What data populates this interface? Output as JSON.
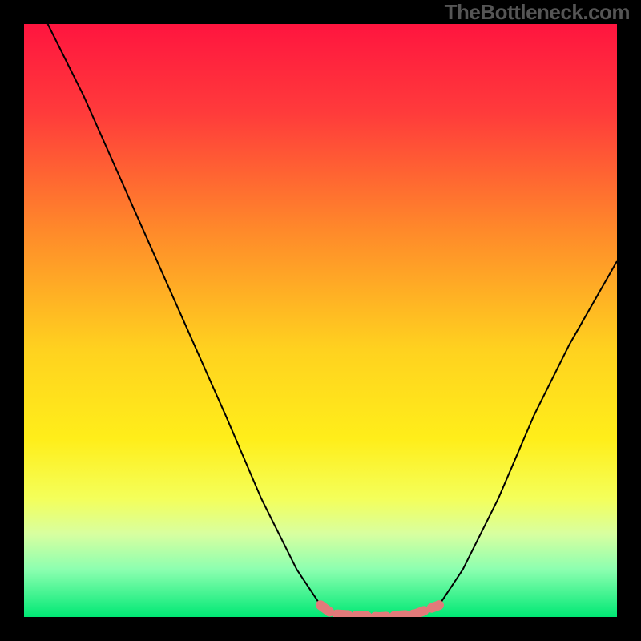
{
  "watermark": "TheBottleneck.com",
  "chart_data": {
    "type": "line",
    "title": "",
    "xlabel": "",
    "ylabel": "",
    "xlim": [
      0,
      100
    ],
    "ylim": [
      0,
      100
    ],
    "gradient_stops": [
      {
        "offset": 0,
        "color": "#ff153f"
      },
      {
        "offset": 15,
        "color": "#ff3b3b"
      },
      {
        "offset": 35,
        "color": "#ff8a2a"
      },
      {
        "offset": 55,
        "color": "#ffd21f"
      },
      {
        "offset": 70,
        "color": "#ffee1a"
      },
      {
        "offset": 80,
        "color": "#f4ff5a"
      },
      {
        "offset": 86,
        "color": "#d8ffa0"
      },
      {
        "offset": 92,
        "color": "#8cffb0"
      },
      {
        "offset": 100,
        "color": "#00e874"
      }
    ],
    "series": [
      {
        "name": "left-curve",
        "stroke": "#000000",
        "data": [
          {
            "x": 4,
            "y": 100
          },
          {
            "x": 10,
            "y": 88
          },
          {
            "x": 18,
            "y": 70
          },
          {
            "x": 26,
            "y": 52
          },
          {
            "x": 34,
            "y": 34
          },
          {
            "x": 40,
            "y": 20
          },
          {
            "x": 46,
            "y": 8
          },
          {
            "x": 50,
            "y": 2
          }
        ]
      },
      {
        "name": "right-curve",
        "stroke": "#000000",
        "data": [
          {
            "x": 70,
            "y": 2
          },
          {
            "x": 74,
            "y": 8
          },
          {
            "x": 80,
            "y": 20
          },
          {
            "x": 86,
            "y": 34
          },
          {
            "x": 92,
            "y": 46
          },
          {
            "x": 100,
            "y": 60
          }
        ]
      }
    ],
    "marker_band": {
      "name": "bottom-marker",
      "stroke": "#e27a7a",
      "width": 12,
      "data": [
        {
          "x": 50,
          "y": 2
        },
        {
          "x": 52,
          "y": 0.5
        },
        {
          "x": 60,
          "y": 0
        },
        {
          "x": 66,
          "y": 0.5
        },
        {
          "x": 70,
          "y": 2
        }
      ]
    }
  }
}
